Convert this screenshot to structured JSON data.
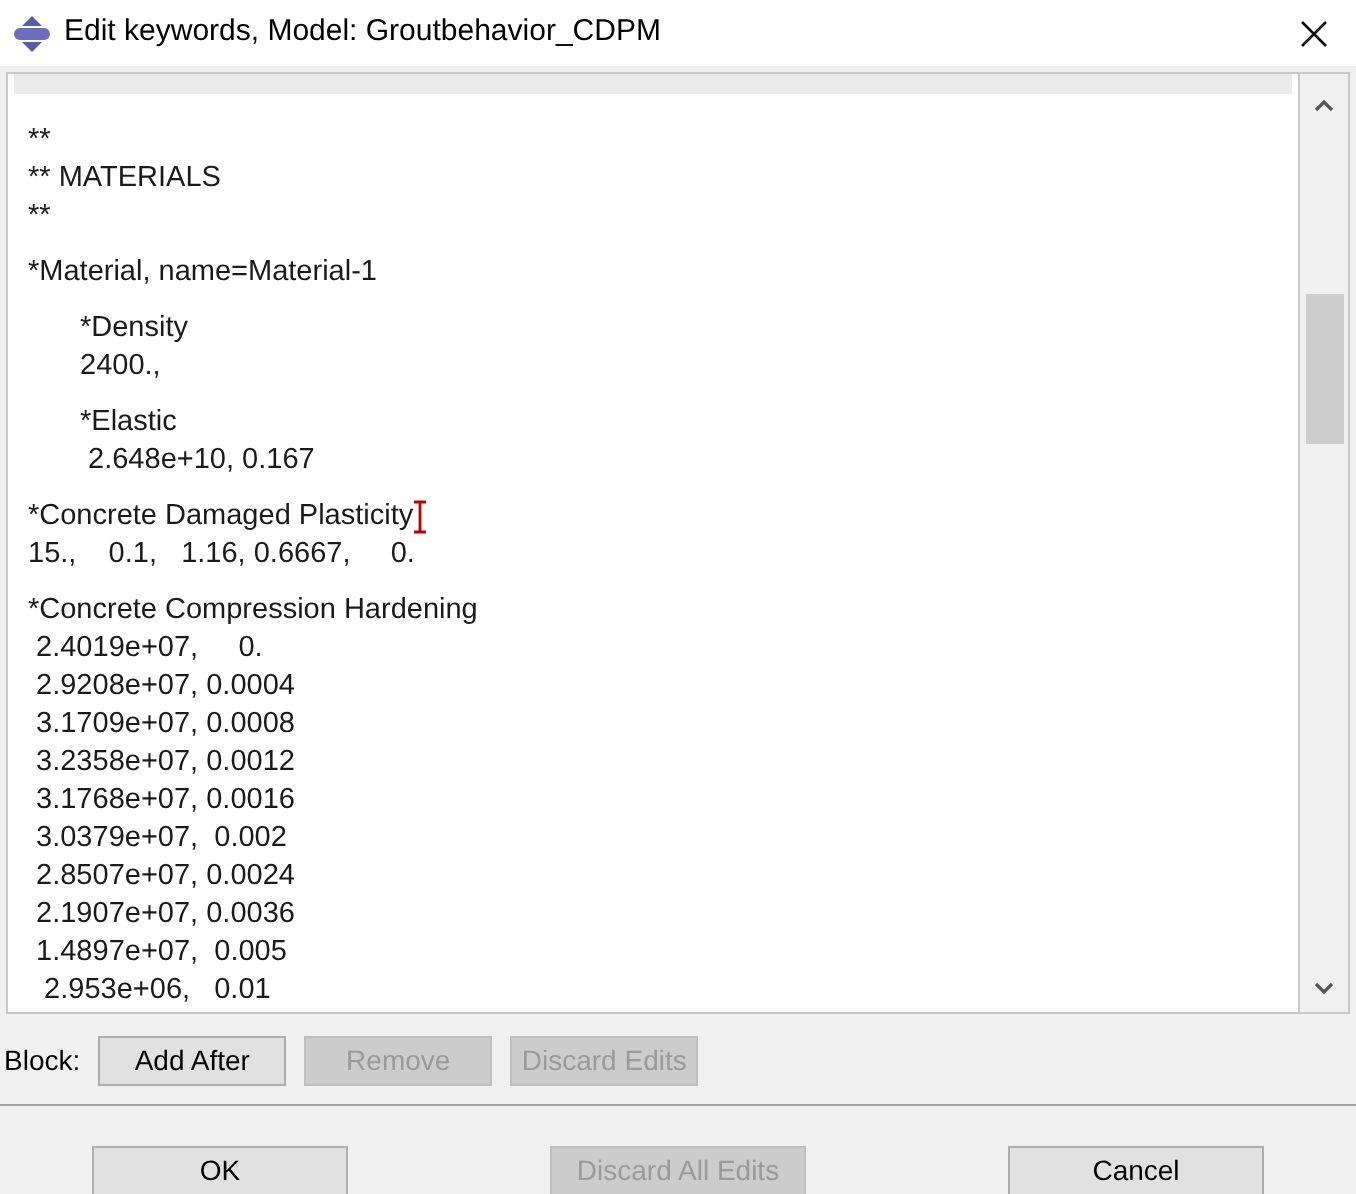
{
  "window": {
    "title": "Edit keywords, Model: Groutbehavior_CDPM"
  },
  "editor": {
    "blocks": [
      {
        "lines": [
          {
            "text": "**",
            "cursor": false
          },
          {
            "text": "** MATERIALS",
            "cursor": false
          },
          {
            "text": "**",
            "cursor": false
          }
        ]
      },
      {
        "lines": [
          {
            "text": "*Material, name=Material-1",
            "cursor": false
          }
        ],
        "children": [
          {
            "lines": [
              {
                "text": "*Density",
                "cursor": false
              },
              {
                "text": "2400.,",
                "cursor": false
              }
            ]
          },
          {
            "lines": [
              {
                "text": "*Elastic",
                "cursor": false
              },
              {
                "text": " 2.648e+10, 0.167",
                "cursor": false
              }
            ]
          }
        ]
      },
      {
        "lines": [
          {
            "text": "*Concrete Damaged Plasticity",
            "cursor": true
          },
          {
            "text": "15.,    0.1,   1.16, 0.6667,     0.",
            "cursor": false
          }
        ]
      },
      {
        "lines": [
          {
            "text": "*Concrete Compression Hardening",
            "cursor": false
          },
          {
            "text": " 2.4019e+07,     0.",
            "cursor": false
          },
          {
            "text": " 2.9208e+07, 0.0004",
            "cursor": false
          },
          {
            "text": " 3.1709e+07, 0.0008",
            "cursor": false
          },
          {
            "text": " 3.2358e+07, 0.0012",
            "cursor": false
          },
          {
            "text": " 3.1768e+07, 0.0016",
            "cursor": false
          },
          {
            "text": " 3.0379e+07,  0.002",
            "cursor": false
          },
          {
            "text": " 2.8507e+07, 0.0024",
            "cursor": false
          },
          {
            "text": " 2.1907e+07, 0.0036",
            "cursor": false
          },
          {
            "text": " 1.4897e+07,  0.005",
            "cursor": false
          },
          {
            "text": "  2.953e+06,   0.01",
            "cursor": false
          }
        ]
      }
    ]
  },
  "block_bar": {
    "label": "Block:",
    "buttons": [
      {
        "label": "Add After",
        "disabled": false
      },
      {
        "label": "Remove",
        "disabled": true
      },
      {
        "label": "Discard Edits",
        "disabled": true
      }
    ]
  },
  "footer": {
    "buttons": [
      {
        "label": "OK",
        "disabled": false
      },
      {
        "label": "Discard All Edits",
        "disabled": true
      },
      {
        "label": "Cancel",
        "disabled": false
      }
    ]
  }
}
